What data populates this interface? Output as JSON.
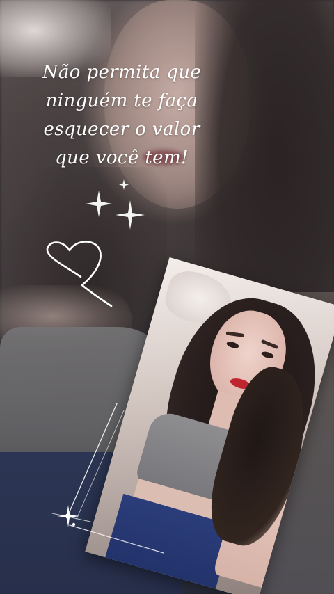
{
  "quote": {
    "lines": [
      "Não permita que",
      "ninguém te faça",
      "esquecer o valor",
      "que você tem!"
    ]
  },
  "colors": {
    "quote_text": "#ffffff",
    "lips": "#c0242f",
    "jeans": "#22326a",
    "top": "#77767a"
  },
  "decorations": {
    "sparkles": "sparkle-stars-icon",
    "heart": "heart-outline-icon",
    "flare": "light-flare-icon"
  }
}
